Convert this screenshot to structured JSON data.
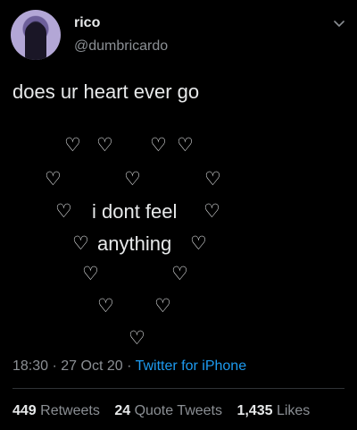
{
  "author": {
    "name": "rico",
    "handle": "@dumbricardo",
    "avatar": "user-avatar"
  },
  "tweet": {
    "line1": "does ur heart ever go",
    "heart_glyph": "♡",
    "line_a": "i dont feel",
    "line_b": "anything",
    "time": "18:30",
    "date": "27 Oct 20",
    "dot": "·",
    "source": "Twitter for iPhone"
  },
  "stats": {
    "retweets_count": "449",
    "retweets_label": "Retweets",
    "quotes_count": "24",
    "quotes_label": "Quote Tweets",
    "likes_count": "1,435",
    "likes_label": "Likes"
  },
  "icons": {
    "chevron": "chevron-down-icon",
    "heart": "heart-outline-glyph"
  },
  "colors": {
    "background": "#000000",
    "text": "#e7e9ea",
    "secondary": "#8b8f94",
    "link": "#1d9bf0",
    "divider": "#2f3336"
  }
}
